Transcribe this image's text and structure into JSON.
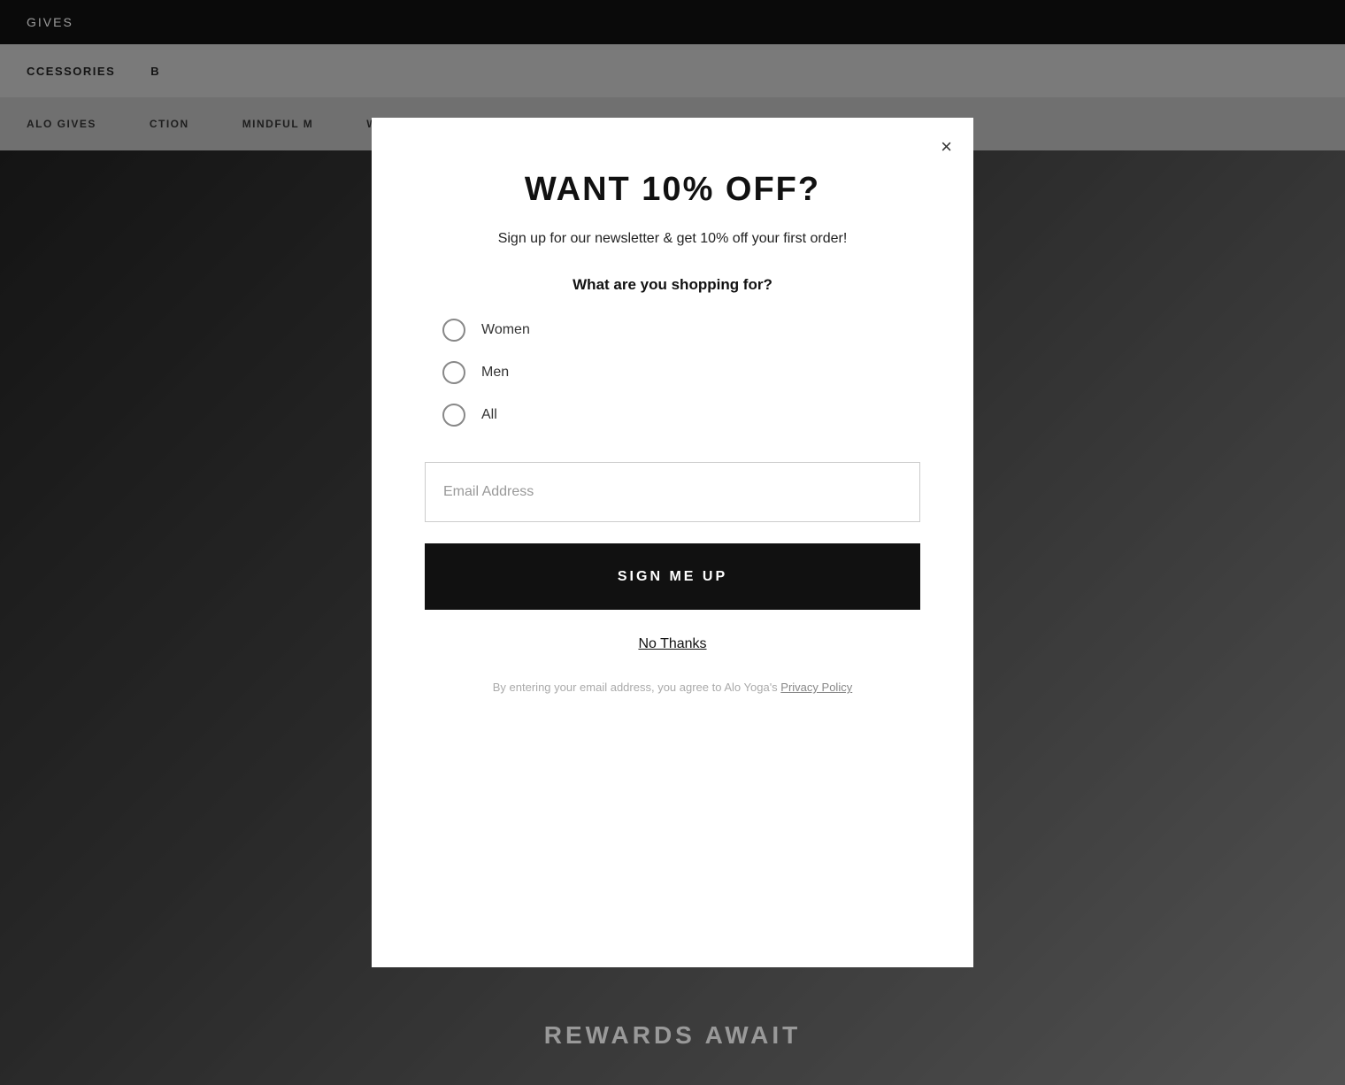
{
  "page": {
    "topBar": {
      "text": "GIVES"
    },
    "nav": {
      "items": [
        "CCESSORIES",
        "B"
      ]
    },
    "subnav": {
      "items": [
        "ALO GIVES",
        "CTION",
        "MINDFUL M",
        "W"
      ]
    },
    "bottomText": "REWARDS AWAIT"
  },
  "modal": {
    "closeLabel": "×",
    "title": "WANT 10% OFF?",
    "subtitle": "Sign up for our newsletter & get 10% off your first order!",
    "question": "What are you shopping for?",
    "options": [
      {
        "id": "women",
        "label": "Women"
      },
      {
        "id": "men",
        "label": "Men"
      },
      {
        "id": "all",
        "label": "All"
      }
    ],
    "emailPlaceholder": "Email Address",
    "signUpLabel": "SIGN ME UP",
    "noThanksLabel": "No Thanks",
    "privacyText": "By entering your email address, you agree to Alo Yoga's ",
    "privacyLinkText": "Privacy Policy"
  }
}
